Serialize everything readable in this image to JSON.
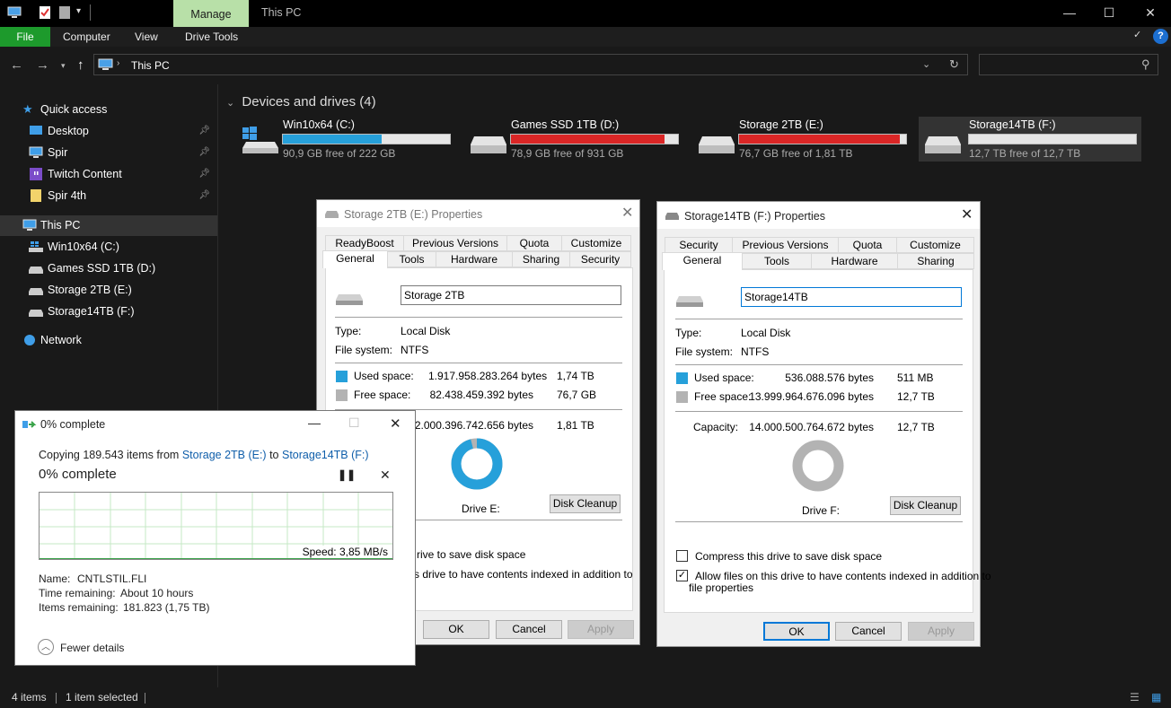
{
  "titlebar": {
    "manage_tab": "Manage",
    "title": "This PC"
  },
  "ribbon": {
    "tabs": [
      "File",
      "Computer",
      "View",
      "Drive Tools"
    ],
    "help": "?"
  },
  "address": {
    "path": "This PC"
  },
  "nav": {
    "quick_access": "Quick access",
    "items": [
      "Desktop",
      "Spir",
      "Twitch Content",
      "Spir 4th"
    ],
    "this_pc": "This PC",
    "drives": [
      "Win10x64 (C:)",
      "Games SSD 1TB (D:)",
      "Storage 2TB (E:)",
      "Storage14TB (F:)"
    ],
    "network": "Network"
  },
  "content": {
    "group_title": "Devices and drives (4)",
    "drives": [
      {
        "name": "Win10x64 (C:)",
        "free": "90,9 GB free of 222 GB",
        "used_fraction": 0.59,
        "color": "#26a0da"
      },
      {
        "name": "Games SSD 1TB (D:)",
        "free": "78,9 GB free of 931 GB",
        "used_fraction": 0.92,
        "color": "#da2626"
      },
      {
        "name": "Storage 2TB (E:)",
        "free": "76,7 GB free of 1,81 TB",
        "used_fraction": 0.96,
        "color": "#da2626"
      },
      {
        "name": "Storage14TB (F:)",
        "free": "12,7 TB free of 12,7 TB",
        "used_fraction": 0.0,
        "color": "#26a0da"
      }
    ]
  },
  "statusbar": {
    "items": "4 items",
    "selected": "1 item selected"
  },
  "props_e": {
    "title": "Storage 2TB (E:) Properties",
    "tabs_top": [
      "ReadyBoost",
      "Previous Versions",
      "Quota",
      "Customize"
    ],
    "tabs_bottom": [
      "General",
      "Tools",
      "Hardware",
      "Sharing",
      "Security"
    ],
    "name": "Storage 2TB",
    "type_label": "Type:",
    "type_value": "Local Disk",
    "fs_label": "File system:",
    "fs_value": "NTFS",
    "used_label": "Used space:",
    "used_bytes": "1.917.958.283.264 bytes",
    "used_h": "1,74 TB",
    "free_label": "Free space:",
    "free_bytes": "82.438.459.392 bytes",
    "free_h": "76,7 GB",
    "cap_bytes": "2.000.396.742.656 bytes",
    "cap_h": "1,81 TB",
    "drive_label": "Drive E:",
    "cleanup": "Disk Cleanup",
    "compress_partial": "rive to save disk space",
    "index_partial": "s drive to have contents indexed in addition to",
    "ok": "OK",
    "cancel": "Cancel",
    "apply": "Apply",
    "used_fraction": 0.96
  },
  "props_f": {
    "title": "Storage14TB (F:) Properties",
    "tabs_top": [
      "Security",
      "Previous Versions",
      "Quota",
      "Customize"
    ],
    "tabs_bottom": [
      "General",
      "Tools",
      "Hardware",
      "Sharing"
    ],
    "name": "Storage14TB",
    "type_label": "Type:",
    "type_value": "Local Disk",
    "fs_label": "File system:",
    "fs_value": "NTFS",
    "used_label": "Used space:",
    "used_bytes": "536.088.576 bytes",
    "used_h": "511 MB",
    "free_label": "Free space:",
    "free_bytes": "13.999.964.676.096 bytes",
    "free_h": "12,7 TB",
    "cap_label": "Capacity:",
    "cap_bytes": "14.000.500.764.672 bytes",
    "cap_h": "12,7 TB",
    "drive_label": "Drive F:",
    "cleanup": "Disk Cleanup",
    "compress": "Compress this drive to save disk space",
    "index": "Allow files on this drive to have contents indexed in addition to",
    "index2": "file properties",
    "ok": "OK",
    "cancel": "Cancel",
    "apply": "Apply",
    "used_fraction": 0.0
  },
  "copy": {
    "title": "0% complete",
    "copying_prefix": "Copying 189.543 items from ",
    "from": "Storage 2TB (E:)",
    "to_word": " to ",
    "to": "Storage14TB (F:)",
    "progress": "0% complete",
    "speed": "Speed: 3,85 MB/s",
    "name_label": "Name:",
    "name_value": "CNTLSTIL.FLI",
    "time_label": "Time remaining:",
    "time_value": "About 10 hours",
    "items_label": "Items remaining:",
    "items_value": "181.823 (1,75 TB)",
    "fewer": "Fewer details"
  }
}
